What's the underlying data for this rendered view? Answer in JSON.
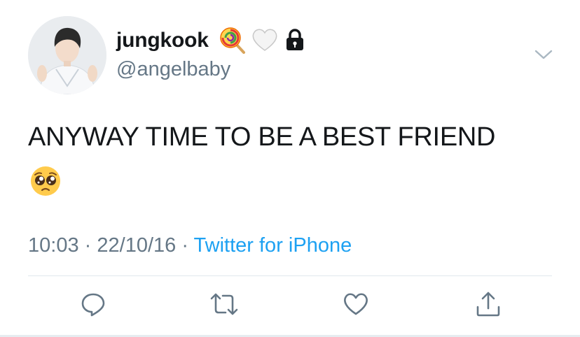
{
  "author": {
    "display_name": "jungkook",
    "handle": "@angelbaby",
    "badges": [
      "lollipop-icon",
      "white-heart-icon",
      "lock-icon"
    ],
    "avatar": "avatar"
  },
  "tweet": {
    "text": "ANYWAY TIME TO BE A BEST FRIEND",
    "emoji": "pleading-face-icon"
  },
  "meta": {
    "time": "10:03",
    "separator": "·",
    "date": "22/10/16",
    "source": "Twitter for iPhone"
  },
  "actions": [
    "reply-icon",
    "retweet-icon",
    "like-icon",
    "share-icon"
  ],
  "colors": {
    "text": "#14171a",
    "secondary": "#657786",
    "link": "#1da1f2",
    "divider": "#e1e8ed",
    "icon": "#657786"
  }
}
